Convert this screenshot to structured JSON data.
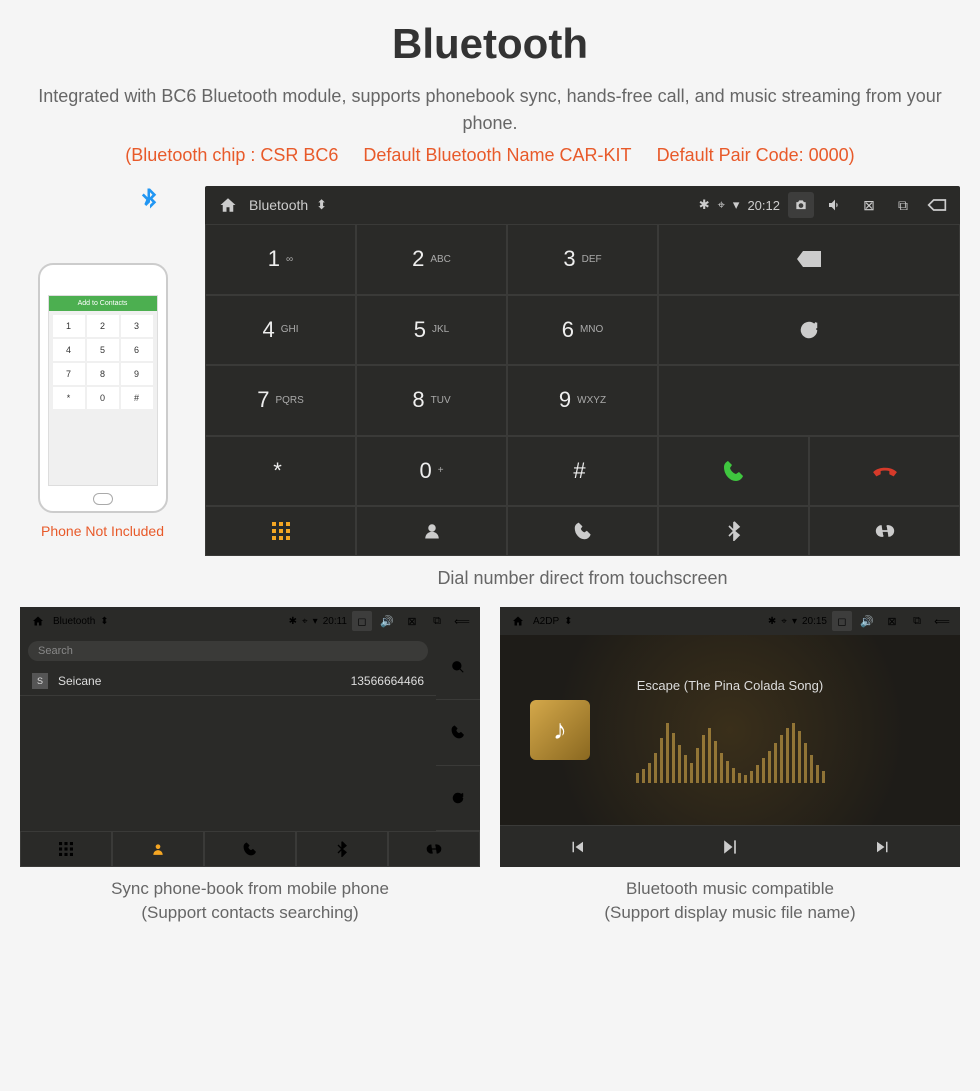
{
  "header": {
    "title": "Bluetooth",
    "desc": "Integrated with BC6 Bluetooth module, supports phonebook sync, hands-free call, and music streaming from your phone.",
    "spec_chip": "(Bluetooth chip : CSR BC6",
    "spec_name": "Default Bluetooth Name CAR-KIT",
    "spec_code": "Default Pair Code: 0000)"
  },
  "phone": {
    "top_label": "Add to Contacts",
    "keys": [
      "1",
      "2",
      "3",
      "4",
      "5",
      "6",
      "7",
      "8",
      "9",
      "*",
      "0",
      "#"
    ],
    "caption": "Phone Not Included"
  },
  "dialer": {
    "title": "Bluetooth",
    "time": "20:12",
    "keys": [
      {
        "d": "1",
        "s": "∞"
      },
      {
        "d": "2",
        "s": "ABC"
      },
      {
        "d": "3",
        "s": "DEF"
      },
      {
        "d": "4",
        "s": "GHI"
      },
      {
        "d": "5",
        "s": "JKL"
      },
      {
        "d": "6",
        "s": "MNO"
      },
      {
        "d": "7",
        "s": "PQRS"
      },
      {
        "d": "8",
        "s": "TUV"
      },
      {
        "d": "9",
        "s": "WXYZ"
      },
      {
        "d": "*",
        "s": ""
      },
      {
        "d": "0",
        "s": "+"
      },
      {
        "d": "#",
        "s": ""
      }
    ],
    "caption": "Dial number direct from touchscreen"
  },
  "contacts": {
    "title": "Bluetooth",
    "time": "20:11",
    "search": "Search",
    "list": [
      {
        "badge": "S",
        "name": "Seicane",
        "number": "13566664466"
      }
    ],
    "caption1": "Sync phone-book from mobile phone",
    "caption2": "(Support contacts searching)"
  },
  "music": {
    "title": "A2DP",
    "time": "20:15",
    "song": "Escape (The Pina Colada Song)",
    "caption1": "Bluetooth music compatible",
    "caption2": "(Support display music file name)"
  }
}
